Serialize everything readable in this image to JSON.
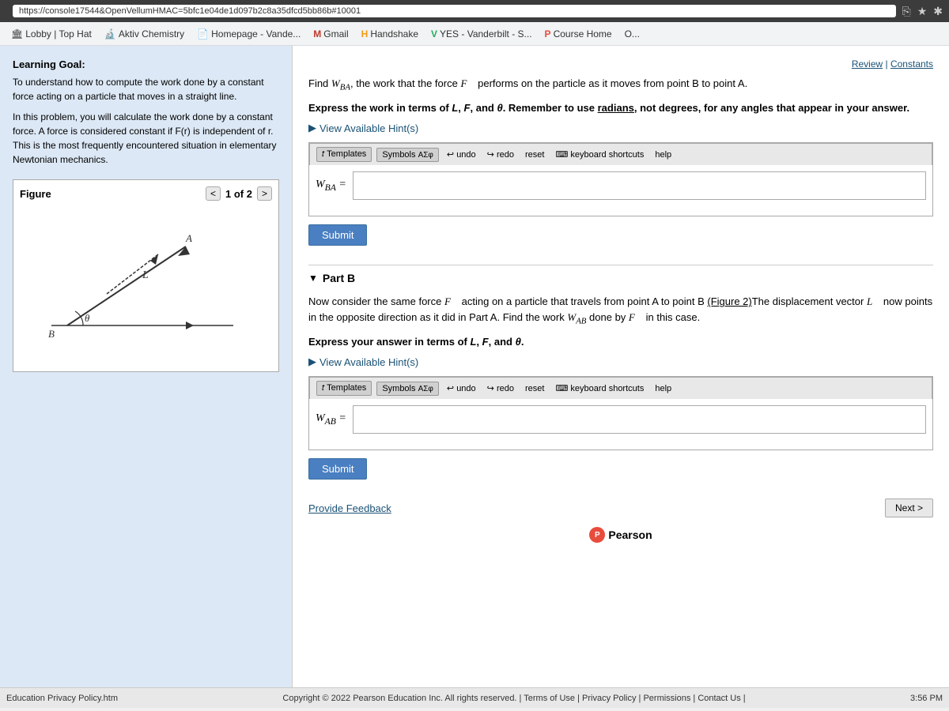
{
  "browser": {
    "url": "https://console17544&OpenVellumHMAC=5bfc1e04de1d097b2c8a35dfcd5bb86b#10001",
    "icons": [
      "⎘",
      "★",
      "✱"
    ]
  },
  "bookmarks": [
    {
      "id": "lobby",
      "label": "Lobby | Top Hat",
      "icon": "🏛"
    },
    {
      "id": "aktiv",
      "label": "Aktiv Chemistry",
      "icon": "🔬"
    },
    {
      "id": "homepage",
      "label": "Homepage - Vande...",
      "icon": "📄"
    },
    {
      "id": "gmail",
      "label": "Gmail",
      "icon": "M"
    },
    {
      "id": "handshake",
      "label": "Handshake",
      "icon": "H"
    },
    {
      "id": "yes",
      "label": "YES - Vanderbilt - S...",
      "icon": "V"
    },
    {
      "id": "coursehome",
      "label": "Course Home",
      "icon": "P"
    },
    {
      "id": "other",
      "label": "O...",
      "icon": ""
    }
  ],
  "sidebar": {
    "learning_goal_label": "Learning Goal:",
    "learning_goal_text": "To understand how to compute the work done by a constant force acting on a particle that moves in a straight line.",
    "problem_desc": "In this problem, you will calculate the work done by a constant force. A force is considered constant if F(r) is independent of r. This is the most frequently encountered situation in elementary Newtonian mechanics.",
    "figure_label": "Figure",
    "figure_nav": "1 of 2"
  },
  "content": {
    "review_label": "Review",
    "constants_label": "Constants",
    "separator": "|",
    "part_a": {
      "problem": "Find W_BA, the work that the force F performs on the particle as it moves from point B to point A.",
      "instruction": "Express the work in terms of L, F, and θ. Remember to use radians, not degrees, for any angles that appear in your answer.",
      "hint_label": "View Available Hint(s)",
      "toolbar": {
        "templates_label": "Templates",
        "symbols_label": "Symbols",
        "undo_label": "undo",
        "redo_label": "redo",
        "reset_label": "reset",
        "keyboard_label": "keyboard shortcuts",
        "help_label": "help",
        "greek_label": "ΑΣφ"
      },
      "input_label": "W_BA =",
      "submit_label": "Submit"
    },
    "part_b": {
      "part_label": "Part B",
      "problem": "Now consider the same force F acting on a particle that travels from point A to point B (Figure 2). The displacement vector L now points in the opposite direction as it did in Part A. Find the work W_AB done by F in this case.",
      "instruction": "Express your answer in terms of L, F, and θ.",
      "hint_label": "View Available Hint(s)",
      "toolbar": {
        "templates_label": "Templates",
        "symbols_label": "Symbols",
        "undo_label": "undo",
        "redo_label": "redo",
        "reset_label": "reset",
        "keyboard_label": "keyboard shortcuts",
        "help_label": "help",
        "greek_label": "ΑΣφ"
      },
      "input_label": "W_AB =",
      "submit_label": "Submit"
    },
    "provide_feedback_label": "Provide Feedback",
    "next_label": "Next >"
  },
  "pearson": {
    "icon_text": "P",
    "brand_label": "Pearson"
  },
  "footer": {
    "edu_link": "Education Privacy Policy.htm",
    "copyright": "Copyright © 2022 Pearson Education Inc. All rights reserved. | Terms of Use | Privacy Policy | Permissions | Contact Us |",
    "time": "3:56 PM"
  }
}
